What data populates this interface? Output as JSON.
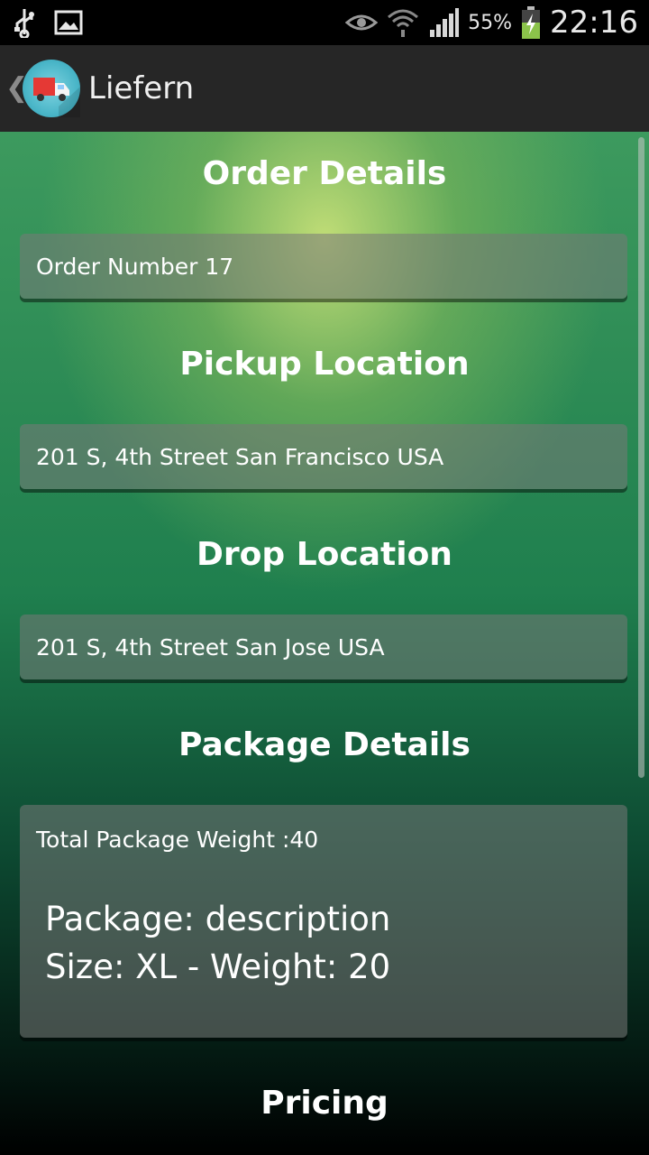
{
  "status_bar": {
    "battery": "55%",
    "time": "22:16",
    "icons": [
      "usb-icon",
      "gallery-icon",
      "eye-icon",
      "wifi-icon",
      "signal-icon",
      "battery-charging-icon"
    ]
  },
  "action_bar": {
    "title": "Liefern",
    "icon": "delivery-truck-icon"
  },
  "sections": {
    "order": {
      "title": "Order Details",
      "value": "Order Number 17"
    },
    "pickup": {
      "title": "Pickup Location",
      "value": "201 S, 4th Street San Francisco USA"
    },
    "drop": {
      "title": "Drop Location",
      "value": "201 S, 4th Street San Jose USA"
    },
    "package": {
      "title": "Package Details",
      "total_weight": "Total Package Weight :40",
      "line1": "Package: description",
      "line2": "Size: XL - Weight: 20"
    },
    "pricing": {
      "title": "Pricing"
    }
  }
}
